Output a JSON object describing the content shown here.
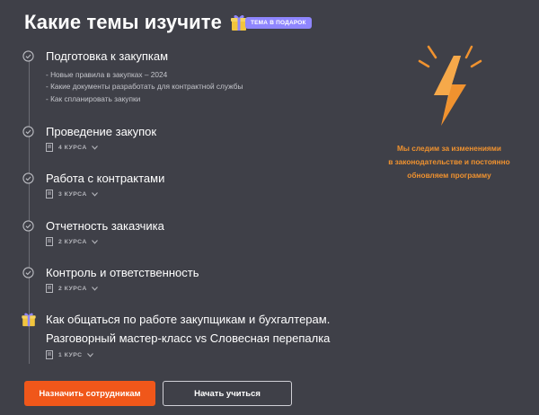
{
  "header": {
    "title": "Какие темы изучите",
    "gift_badge": "Тема в подарок"
  },
  "topics": [
    {
      "title": "Подготовка к закупкам",
      "items": [
        "- Новые правила в закупках – 2024",
        "- Какие документы разработать для контрактной службы",
        "- Как спланировать закупки"
      ]
    },
    {
      "title": "Проведение закупок",
      "courses": "4 КУРСА"
    },
    {
      "title": "Работа с контрактами",
      "courses": "3 КУРСА"
    },
    {
      "title": "Отчетность заказчика",
      "courses": "2 КУРСА"
    },
    {
      "title": "Контроль и ответственность",
      "courses": "2 КУРСА"
    },
    {
      "title_line1": "Как общаться по работе закупщикам и бухгалтерам.",
      "title_line2": "Разговорный мастер-класс vs Словесная перепалка",
      "courses": "1 КУРС"
    }
  ],
  "promo": {
    "line1": "Мы следим за изменениями",
    "line2": "в законодательстве и постоянно",
    "line3": "обновляем программу"
  },
  "buttons": {
    "assign": "Назначить сотрудникам",
    "start": "Начать учиться"
  },
  "colors": {
    "background": "#3f4048",
    "accent_orange": "#f0571a",
    "promo_orange": "#f0922f",
    "badge_purple": "#8f86ff"
  }
}
